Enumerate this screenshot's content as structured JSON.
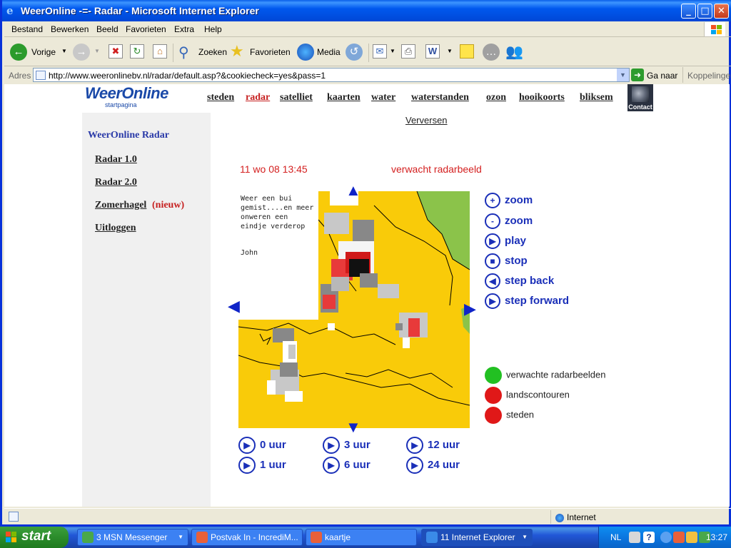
{
  "window": {
    "title": "WeerOnline -=- Radar - Microsoft Internet Explorer",
    "buttons": {
      "minimize": "_",
      "maximize": "□",
      "close": "✕"
    }
  },
  "menubar": {
    "items": [
      "Bestand",
      "Bewerken",
      "Beeld",
      "Favorieten",
      "Extra",
      "Help"
    ]
  },
  "toolbar": {
    "back_label": "Vorige",
    "search_label": "Zoeken",
    "favorites_label": "Favorieten",
    "media_label": "Media"
  },
  "addressbar": {
    "label": "Adres",
    "url": "http://www.weeronlinebv.nl/radar/default.asp?&cookiecheck=yes&pass=1",
    "go_label": "Ga naar",
    "links_label": "Koppelingen"
  },
  "site": {
    "logo_text": "WeerOnline",
    "logo_sub": "startpagina",
    "nav": [
      "steden",
      "radar",
      "satelliet",
      "kaarten",
      "water",
      "waterstanden",
      "ozon",
      "hooikoorts",
      "bliksem"
    ],
    "active_nav": "radar",
    "contact_label": "Contact"
  },
  "sidebar": {
    "title": "WeerOnline Radar",
    "links": [
      "Radar 1.0",
      "Radar 2.0",
      "Zomerhagel",
      "Uitloggen"
    ],
    "new_badge": "(nieuw)"
  },
  "radar": {
    "refresh_label": "Verversen",
    "timestamp": "11 wo 08 13:45",
    "mode_label": "verwacht radarbeeld",
    "note_text": "Weer een bui gemist....en meer onweren een eindje verderop",
    "note_author": "John",
    "controls": [
      {
        "icon": "+",
        "label": "zoom"
      },
      {
        "icon": "-",
        "label": "zoom"
      },
      {
        "icon": "▶",
        "label": "play"
      },
      {
        "icon": "■",
        "label": "stop"
      },
      {
        "icon": "◀",
        "label": "step back"
      },
      {
        "icon": "▶",
        "label": "step forward"
      }
    ],
    "legend": [
      {
        "label": "verwachte radarbeelden",
        "color": "#22c022"
      },
      {
        "label": "landscontouren",
        "color": "#e01818"
      },
      {
        "label": "steden",
        "color": "#e01818"
      }
    ],
    "hours": [
      "0 uur",
      "1 uur",
      "3 uur",
      "6 uur",
      "12 uur",
      "24 uur"
    ]
  },
  "statusbar": {
    "zone_label": "Internet"
  },
  "taskbar": {
    "start_label": "start",
    "tasks": [
      "3 MSN Messenger",
      "Postvak In - IncrediM...",
      "kaartje",
      "11 Internet Explorer"
    ],
    "language": "NL",
    "clock": "13:27"
  },
  "colors": {
    "map_background": "#f9cb09",
    "accent_blue": "#1a2fb8",
    "accent_red": "#d42020"
  }
}
